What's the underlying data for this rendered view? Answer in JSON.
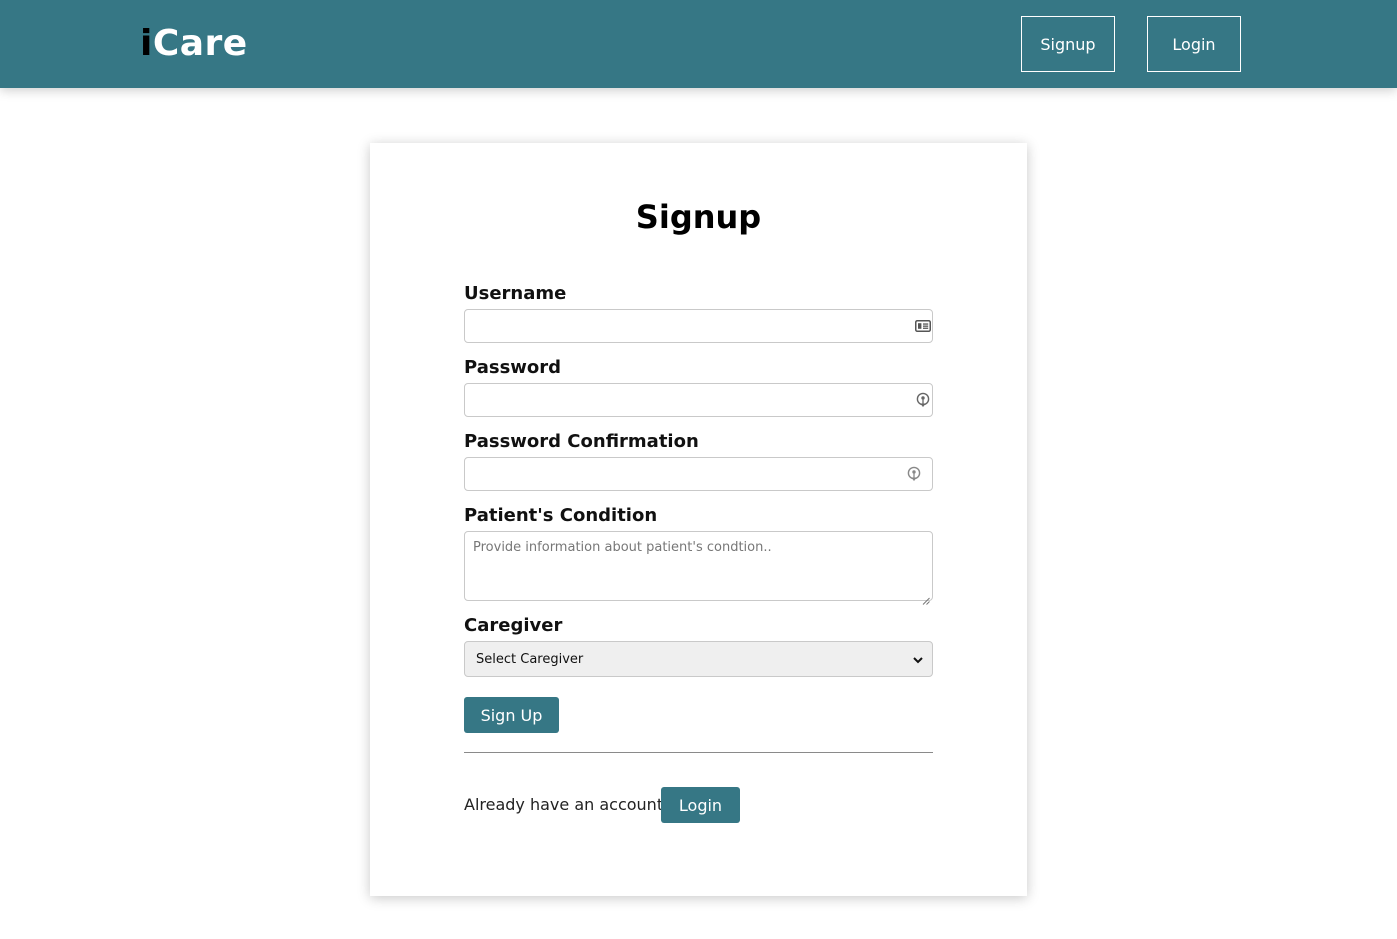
{
  "navbar": {
    "brand_i": "i",
    "brand_rest": "Care",
    "signup_label": "Signup",
    "login_label": "Login"
  },
  "form": {
    "title": "Signup",
    "username_label": "Username",
    "username_value": "",
    "password_label": "Password",
    "password_value": "",
    "password_confirmation_label": "Password Confirmation",
    "password_confirmation_value": "",
    "condition_label": "Patient's Condition",
    "condition_placeholder": "Provide information about patient's condtion..",
    "caregiver_label": "Caregiver",
    "caregiver_selected": "Select Caregiver",
    "submit_label": "Sign Up",
    "already_text": "Already have an account?",
    "login_label": "Login"
  },
  "icons": {
    "username_field": "id-card-icon",
    "password_field": "password-manager-icon",
    "password_confirmation_field": "password-manager-icon",
    "select": "chevron-down-icon"
  },
  "colors": {
    "primary": "#367785",
    "brand_i": "#000000",
    "brand_text": "#ffffff"
  }
}
